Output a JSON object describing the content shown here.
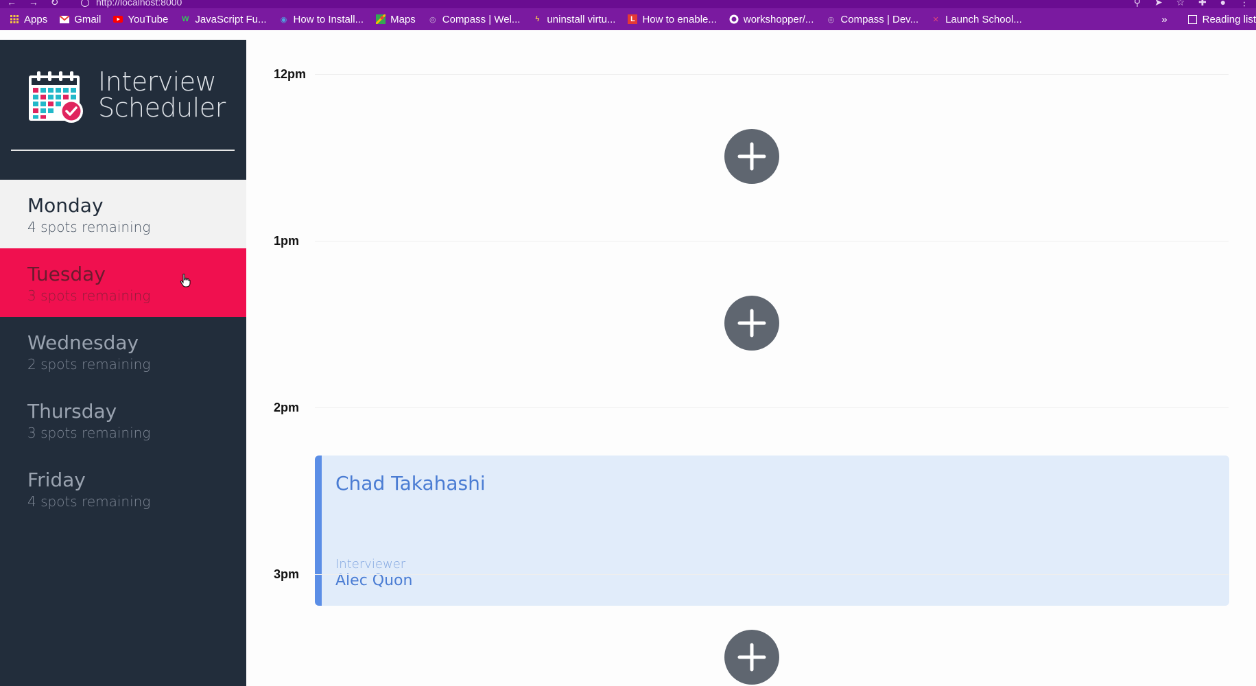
{
  "browser": {
    "url": "http://localhost:8000",
    "bookmarks": [
      {
        "label": "Apps",
        "icon": "apps-grid-icon",
        "color": "#f4c542"
      },
      {
        "label": "Gmail",
        "icon": "gmail-icon",
        "color": "#ea4335"
      },
      {
        "label": "YouTube",
        "icon": "youtube-icon",
        "color": "#ff0000"
      },
      {
        "label": "JavaScript Fu...",
        "icon": "bookmark-w-icon",
        "color": "#34c759"
      },
      {
        "label": "How to Install...",
        "icon": "bookmark-globe-icon",
        "color": "#4fa3e0"
      },
      {
        "label": "Maps",
        "icon": "maps-icon",
        "color": "#34a853"
      },
      {
        "label": "Compass | Wel...",
        "icon": "compass-icon",
        "color": "#c9b4d6"
      },
      {
        "label": "uninstall virtu...",
        "icon": "bookmark-bolt-icon",
        "color": "#ffd54a"
      },
      {
        "label": "How to enable...",
        "icon": "bookmark-l-icon",
        "color": "#e53935"
      },
      {
        "label": "workshopper/...",
        "icon": "github-icon",
        "color": "#ffffff"
      },
      {
        "label": "Compass | Dev...",
        "icon": "compass-icon",
        "color": "#c9b4d6"
      },
      {
        "label": "Launch School...",
        "icon": "launch-school-icon",
        "color": "#e0457b"
      }
    ],
    "more": "»",
    "reading_list": "Reading list"
  },
  "app": {
    "title_line1": "Interview",
    "title_line2": "Scheduler"
  },
  "days": [
    {
      "name": "Monday",
      "spots": "4 spots remaining"
    },
    {
      "name": "Tuesday",
      "spots": "3 spots remaining"
    },
    {
      "name": "Wednesday",
      "spots": "2 spots remaining"
    },
    {
      "name": "Thursday",
      "spots": "3 spots remaining"
    },
    {
      "name": "Friday",
      "spots": "4 spots remaining"
    }
  ],
  "schedule": {
    "slots": [
      {
        "time": "12pm"
      },
      {
        "time": "1pm"
      },
      {
        "time": "2pm"
      },
      {
        "time": "3pm"
      }
    ],
    "appointment": {
      "student": "Chad Takahashi",
      "interviewer_label": "Interviewer",
      "interviewer": "Alec Quon"
    }
  },
  "colors": {
    "sidebar_bg": "#222d3b",
    "selected_day_bg": "#f2f2f2",
    "hover_day_bg": "#f0104f",
    "add_button": "#5f6670",
    "appointment_bg": "#e1ecfa",
    "appointment_accent": "#5b8ee6"
  }
}
